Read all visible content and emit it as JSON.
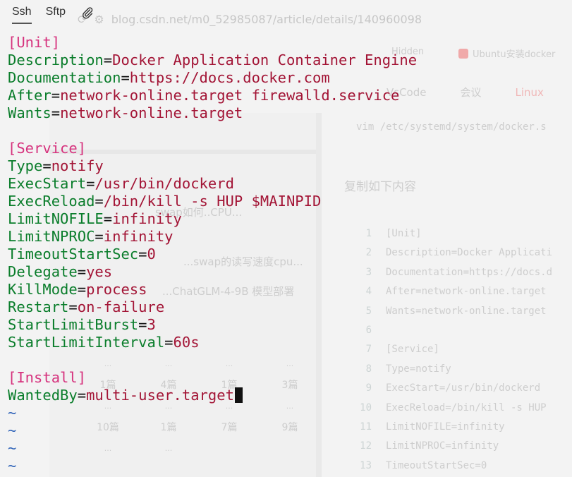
{
  "tabs": [
    {
      "label": "Ssh",
      "active": true
    },
    {
      "label": "Sftp",
      "active": false
    }
  ],
  "attach_icon": "paperclip-icon",
  "colors": {
    "key": "#0a7d2b",
    "value": "#a31536",
    "section": "#d6337e",
    "tilde": "#2f63b8",
    "cursor": "#111111"
  },
  "terminal": {
    "lines": [
      {
        "type": "section",
        "text": "[Unit]"
      },
      {
        "type": "kv",
        "key": "Description",
        "value": "Docker Application Container Engine"
      },
      {
        "type": "kv",
        "key": "Documentation",
        "value": "https://docs.docker.com"
      },
      {
        "type": "kv",
        "key": "After",
        "value": "network-online.target firewalld.service"
      },
      {
        "type": "kv",
        "key": "Wants",
        "value": "network-online.target"
      },
      {
        "type": "blank"
      },
      {
        "type": "section",
        "text": "[Service]"
      },
      {
        "type": "kv",
        "key": "Type",
        "value": "notify"
      },
      {
        "type": "kv",
        "key": "ExecStart",
        "value": "/usr/bin/dockerd"
      },
      {
        "type": "kv",
        "key": "ExecReload",
        "value": "/bin/kill -s HUP $MAINPID"
      },
      {
        "type": "kv",
        "key": "LimitNOFILE",
        "value": "infinity"
      },
      {
        "type": "kv",
        "key": "LimitNPROC",
        "value": "infinity"
      },
      {
        "type": "kv",
        "key": "TimeoutStartSec",
        "value": "0"
      },
      {
        "type": "kv",
        "key": "Delegate",
        "value": "yes"
      },
      {
        "type": "kv",
        "key": "KillMode",
        "value": "process"
      },
      {
        "type": "kv",
        "key": "Restart",
        "value": "on-failure"
      },
      {
        "type": "kv",
        "key": "StartLimitBurst",
        "value": "3"
      },
      {
        "type": "kv",
        "key": "StartLimitInterval",
        "value": "60s"
      },
      {
        "type": "blank"
      },
      {
        "type": "section",
        "text": "[Install]"
      },
      {
        "type": "kv",
        "key": "WantedBy",
        "value": "multi-user.target",
        "cursor": true
      },
      {
        "type": "tilde",
        "text": "~"
      },
      {
        "type": "tilde",
        "text": "~"
      },
      {
        "type": "tilde",
        "text": "~"
      },
      {
        "type": "tilde",
        "text": "~"
      }
    ]
  },
  "background": {
    "url": "blog.csdn.net/m0_52985087/article/details/140960098",
    "bookmarks": [
      "Hidden",
      "Ubuntu安装docker"
    ],
    "page_tabs": [
      "VsCode",
      "会议",
      "Linux"
    ],
    "command": "vim /etc/systemd/system/docker.s",
    "intro": "复制如下内容",
    "left_texts": [
      "swap如何..CPU...",
      "...swap的读写速度cpu...",
      "...ChatGLM-4-9B 模型部署"
    ],
    "grid_rows": [
      [
        "...",
        "...",
        "...",
        "..."
      ],
      [
        "1篇",
        "4篇",
        "1篇",
        "3篇"
      ],
      [
        "...",
        "...",
        "...",
        "..."
      ],
      [
        "10篇",
        "1篇",
        "7篇",
        "9篇"
      ],
      [
        "...",
        "..."
      ]
    ],
    "code_lines": [
      {
        "n": "1",
        "t": "[Unit]"
      },
      {
        "n": "2",
        "t": "Description=Docker Applicati"
      },
      {
        "n": "3",
        "t": "Documentation=https://docs.d"
      },
      {
        "n": "4",
        "t": "After=network-online.target"
      },
      {
        "n": "5",
        "t": "Wants=network-online.target"
      },
      {
        "n": "6",
        "t": ""
      },
      {
        "n": "7",
        "t": "[Service]"
      },
      {
        "n": "8",
        "t": "Type=notify"
      },
      {
        "n": "9",
        "t": "ExecStart=/usr/bin/dockerd"
      },
      {
        "n": "10",
        "t": "ExecReload=/bin/kill -s HUP"
      },
      {
        "n": "11",
        "t": "LimitNOFILE=infinity"
      },
      {
        "n": "12",
        "t": "LimitNPROC=infinity"
      },
      {
        "n": "13",
        "t": "TimeoutStartSec=0"
      }
    ]
  }
}
